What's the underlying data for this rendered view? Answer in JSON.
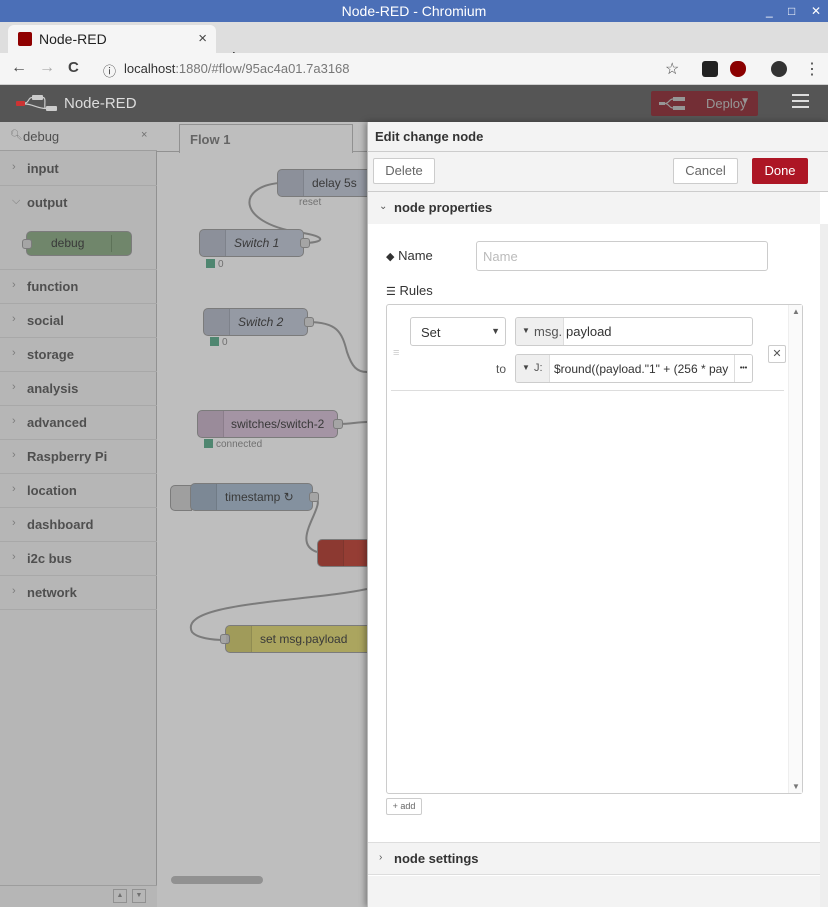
{
  "os_window": {
    "title": "Node-RED - Chromium",
    "minimize_glyph": "_",
    "maximize_glyph": "□",
    "close_glyph": "✕"
  },
  "browser": {
    "tab_title": "Node-RED",
    "tab_close_glyph": "×",
    "new_tab_glyph": "+",
    "url_host": "localhost",
    "url_path": ":1880/#flow/95ac4a01.7a3168",
    "back_glyph": "←",
    "forward_glyph": "→",
    "reload_glyph": "C",
    "info_glyph": "ⓘ",
    "star_glyph": "☆",
    "menu_glyph": "⋮"
  },
  "header": {
    "app_name": "Node-RED",
    "deploy_label": "Deploy",
    "deploy_caret": "▼"
  },
  "palette": {
    "search_value": "debug",
    "search_clear_glyph": "×",
    "categories": [
      {
        "label": "input",
        "expanded": false
      },
      {
        "label": "output",
        "expanded": true
      },
      {
        "label": "function",
        "expanded": false
      },
      {
        "label": "social",
        "expanded": false
      },
      {
        "label": "storage",
        "expanded": false
      },
      {
        "label": "analysis",
        "expanded": false
      },
      {
        "label": "advanced",
        "expanded": false
      },
      {
        "label": "Raspberry Pi",
        "expanded": false
      },
      {
        "label": "location",
        "expanded": false
      },
      {
        "label": "dashboard",
        "expanded": false
      },
      {
        "label": "i2c bus",
        "expanded": false
      },
      {
        "label": "network",
        "expanded": false
      }
    ],
    "debug_node_label": "debug"
  },
  "workspace": {
    "tab_label": "Flow 1",
    "nodes": {
      "delay": {
        "label": "delay 5s",
        "status": "reset"
      },
      "switch1": {
        "label": "Switch 1",
        "status": "0"
      },
      "switch2": {
        "label": "Switch 2",
        "status": "0"
      },
      "mqtt": {
        "label": "switches/switch-2",
        "status": "connected"
      },
      "inject": {
        "label": "timestamp ↻"
      },
      "change": {
        "label": "set msg.payload"
      }
    }
  },
  "tray": {
    "title": "Edit change node",
    "delete_label": "Delete",
    "cancel_label": "Cancel",
    "done_label": "Done",
    "node_properties_label": "node properties",
    "node_settings_label": "node settings",
    "name_label": "Name",
    "name_placeholder": "Name",
    "name_value": "",
    "rules_label": "Rules",
    "rule": {
      "action": "Set",
      "target_type": "msg.",
      "target_value": "payload",
      "to_label": "to",
      "value_type_glyph": "J:",
      "value": "$round((payload.\"1\" + (256 * pay",
      "expand_glyph": "•••",
      "delete_glyph": "✕"
    },
    "add_label": "+ add"
  },
  "colors": {
    "os_titlebar": "#4b6fb7",
    "nr_header": "#555555",
    "deploy": "#8c101c",
    "done_button": "#ad1625",
    "debug_node": "#87a980",
    "switch_node": "#c0c8d8",
    "mqtt_node": "#d8bfd8",
    "inject_node": "#a6bbcf",
    "change_node": "#e2d96e",
    "trigger_node": "#c0392b"
  }
}
